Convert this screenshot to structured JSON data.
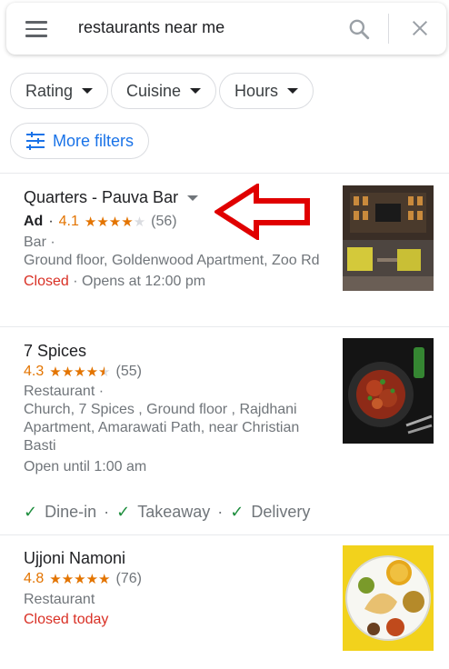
{
  "search": {
    "query": "restaurants near me",
    "menu_icon": "menu-icon",
    "search_icon": "search-icon",
    "close_icon": "close-icon"
  },
  "filters": {
    "rating": "Rating",
    "cuisine": "Cuisine",
    "hours": "Hours",
    "more": "More filters"
  },
  "results": [
    {
      "name": "Quarters - Pauva Bar",
      "ad": "Ad",
      "dot": "·",
      "rating": "4.1",
      "stars": 4.1,
      "count": "(56)",
      "category": "Bar ·",
      "address": "Ground floor, Goldenwood Apartment, Zoo Rd",
      "status": "Closed",
      "status_rest": " · Opens at 12:00 pm"
    },
    {
      "name": "7 Spices",
      "rating": "4.3",
      "stars": 4.3,
      "count": "(55)",
      "category": "Restaurant ·",
      "address_1": "Church, 7 Spices , Ground floor , Rajdhani",
      "address_2": "Apartment, Amarawati Path, near Christian",
      "address_3": "Basti",
      "hours": "Open until 1:00 am",
      "services": [
        "Dine-in",
        "Takeaway",
        "Delivery"
      ],
      "sep": "·"
    },
    {
      "name": "Ujjoni Namoni",
      "rating": "4.8",
      "stars": 4.8,
      "count": "(76)",
      "category": "Restaurant",
      "status": "Closed today"
    }
  ],
  "colors": {
    "accent_blue": "#1a73e8",
    "star_orange": "#e37400",
    "closed_red": "#d93025",
    "check_green": "#1e8e3e",
    "annotation_arrow": "#e00000"
  }
}
